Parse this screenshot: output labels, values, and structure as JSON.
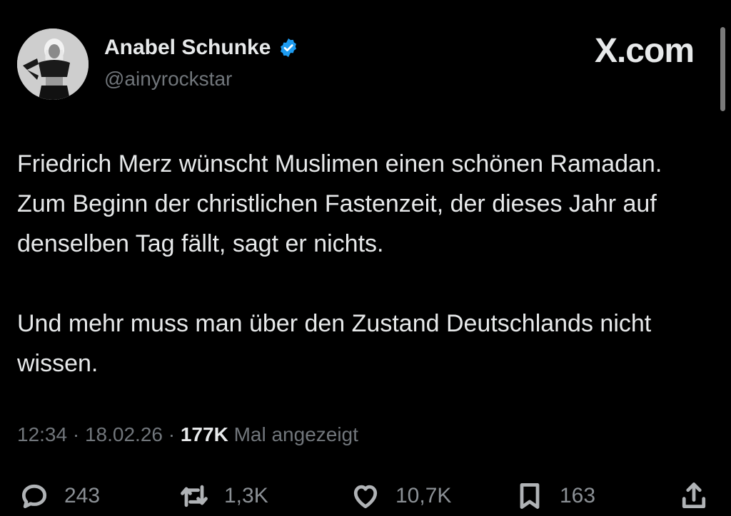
{
  "author": {
    "name": "Anabel Schunke",
    "handle": "@ainyrockstar",
    "verified": true,
    "avatar_icon": "profile-photo"
  },
  "brand": "X.com",
  "tweet": {
    "paragraphs": [
      "Friedrich Merz wünscht Muslimen einen schönen Ramadan. Zum Beginn der christlichen Fastenzeit, der dieses Jahr auf denselben Tag fällt, sagt er nichts.",
      "Und mehr muss man über den Zustand Deutschlands nicht wissen."
    ]
  },
  "meta": {
    "time": "12:34",
    "separator": " · ",
    "date": "18.02.26",
    "views": "177K",
    "views_label": "Mal angezeigt"
  },
  "actions": {
    "replies": "243",
    "reposts": "1,3K",
    "likes": "10,7K",
    "bookmarks": "163"
  },
  "colors": {
    "background": "#000000",
    "text": "#e7e9ea",
    "muted": "#71767b",
    "verified": "#1d9bf0"
  }
}
